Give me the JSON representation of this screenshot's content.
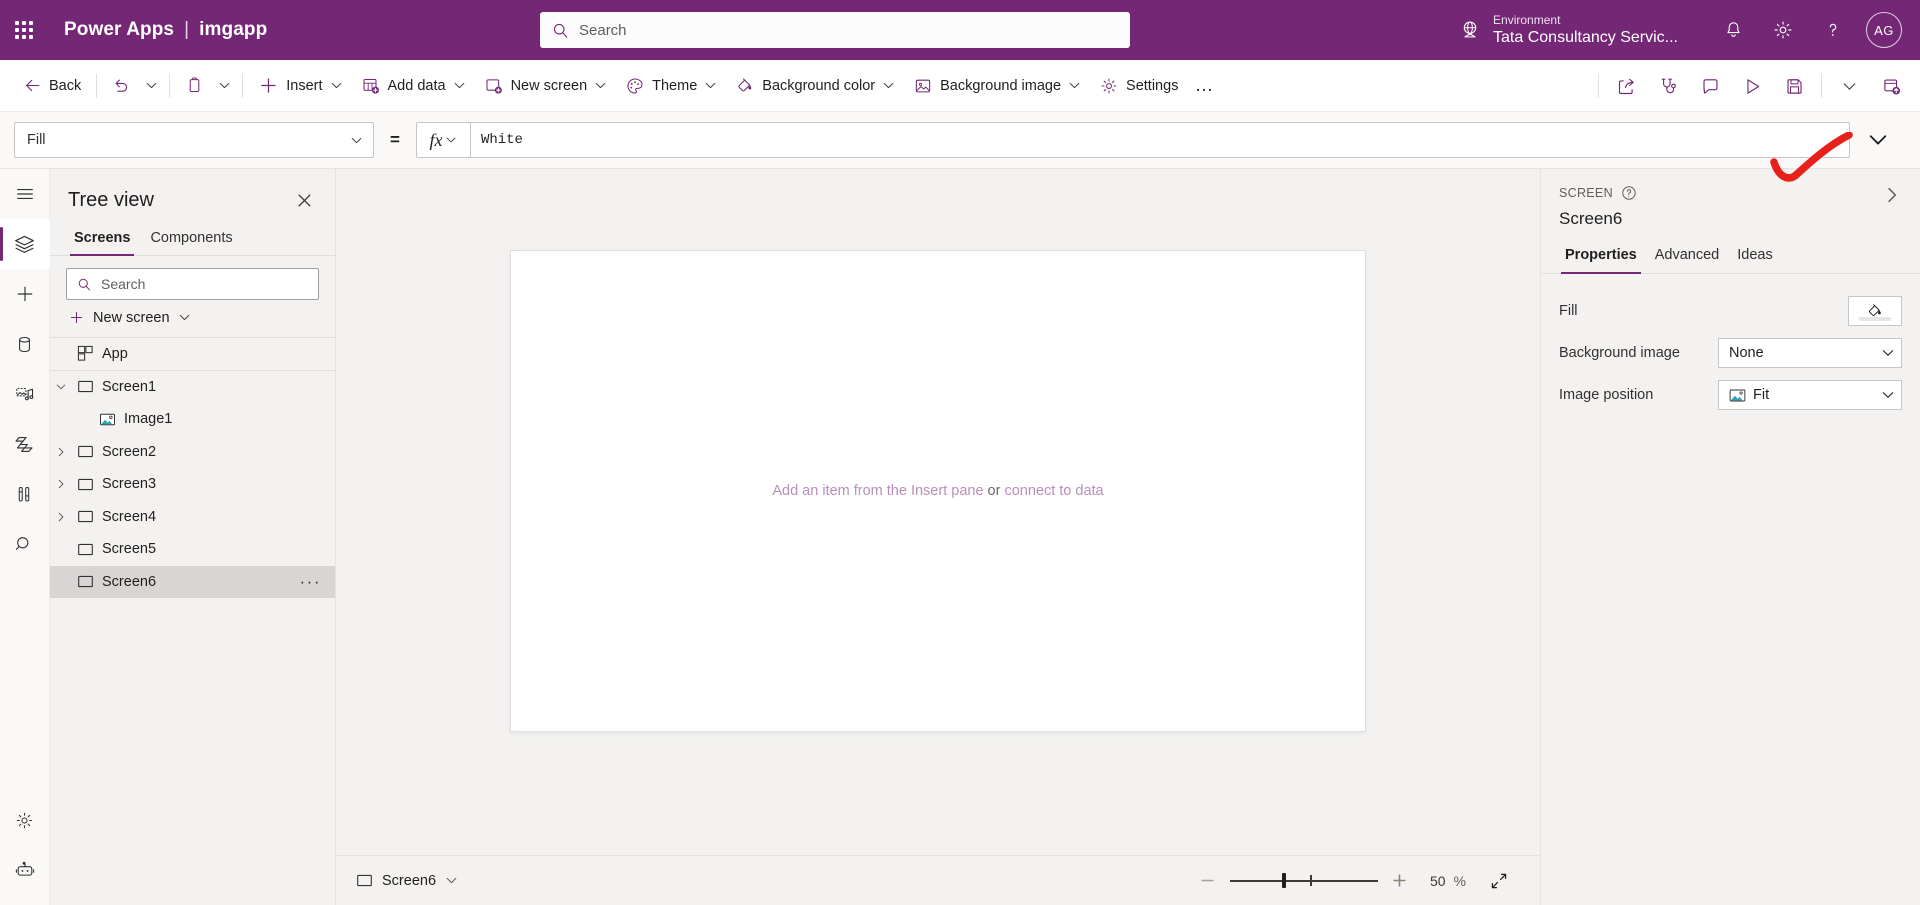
{
  "header": {
    "brand": "Power Apps",
    "separator": "|",
    "app_name": "imgapp",
    "search_placeholder": "Search",
    "environment_label": "Environment",
    "environment_name": "Tata Consultancy Servic...",
    "avatar_initials": "AG",
    "bg_color": "#742774"
  },
  "commandbar": {
    "back": "Back",
    "insert": "Insert",
    "add_data": "Add data",
    "new_screen": "New screen",
    "theme": "Theme",
    "background_color": "Background color",
    "background_image": "Background image",
    "settings": "Settings",
    "overflow": "…"
  },
  "formulabar": {
    "property": "Fill",
    "equals": "=",
    "fx": "fx",
    "value": "White"
  },
  "treeview": {
    "title": "Tree view",
    "tabs": [
      {
        "label": "Screens",
        "active": true
      },
      {
        "label": "Components",
        "active": false
      }
    ],
    "search_placeholder": "Search",
    "new_screen": "New screen",
    "items": [
      {
        "label": "App",
        "icon": "app-icon",
        "indent": 0,
        "caret": "none",
        "selected": false
      },
      {
        "label": "Screen1",
        "icon": "screen-icon",
        "indent": 0,
        "caret": "expanded",
        "selected": false
      },
      {
        "label": "Image1",
        "icon": "image-icon",
        "indent": 1,
        "caret": "none",
        "selected": false
      },
      {
        "label": "Screen2",
        "icon": "screen-icon",
        "indent": 0,
        "caret": "collapsed",
        "selected": false
      },
      {
        "label": "Screen3",
        "icon": "screen-icon",
        "indent": 0,
        "caret": "collapsed",
        "selected": false
      },
      {
        "label": "Screen4",
        "icon": "screen-icon",
        "indent": 0,
        "caret": "collapsed",
        "selected": false
      },
      {
        "label": "Screen5",
        "icon": "screen-icon",
        "indent": 0,
        "caret": "none",
        "selected": false
      },
      {
        "label": "Screen6",
        "icon": "screen-icon",
        "indent": 0,
        "caret": "none",
        "selected": true,
        "more": "···"
      }
    ]
  },
  "canvas": {
    "hint_prefix": "Add an item from the Insert pane ",
    "hint_or": "or ",
    "hint_link": "connect to data"
  },
  "statusbar": {
    "screen_name": "Screen6",
    "zoom_value": "50",
    "zoom_unit": "%"
  },
  "properties": {
    "kicker": "SCREEN",
    "name": "Screen6",
    "tabs": [
      {
        "label": "Properties",
        "active": true
      },
      {
        "label": "Advanced",
        "active": false
      },
      {
        "label": "Ideas",
        "active": false
      }
    ],
    "rows": [
      {
        "label": "Fill",
        "control": "color",
        "value": ""
      },
      {
        "label": "Background image",
        "control": "dropdown",
        "value": "None"
      },
      {
        "label": "Image position",
        "control": "dropdown-icon",
        "value": "Fit"
      }
    ]
  },
  "annotation": {
    "type": "red-check-swoosh",
    "color": "#e8201a"
  }
}
